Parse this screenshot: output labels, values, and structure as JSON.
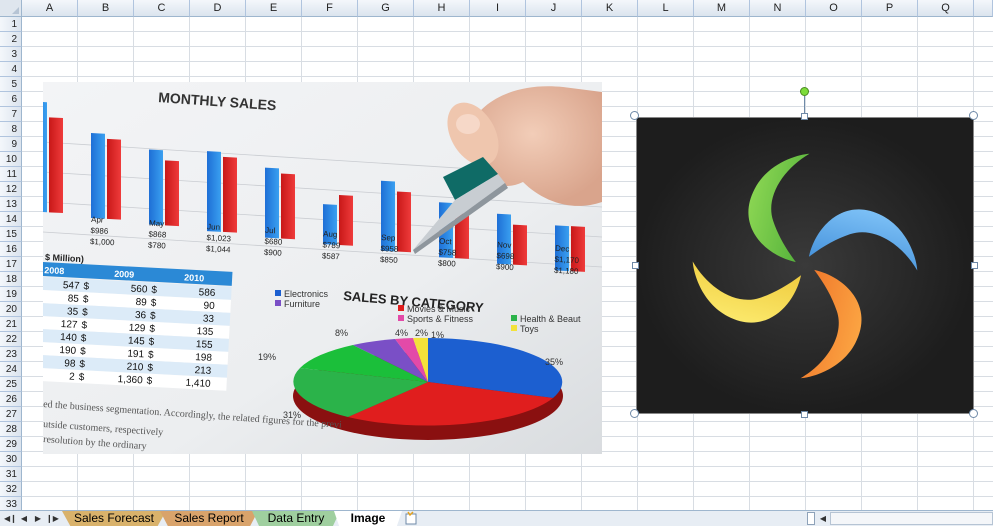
{
  "columns": [
    "A",
    "B",
    "C",
    "D",
    "E",
    "F",
    "G",
    "H",
    "I",
    "J",
    "K",
    "L",
    "M",
    "N",
    "O",
    "P",
    "Q"
  ],
  "rows": [
    "1",
    "2",
    "3",
    "4",
    "5",
    "6",
    "7",
    "8",
    "9",
    "10",
    "11",
    "12",
    "13",
    "14",
    "15",
    "16",
    "17",
    "18",
    "19",
    "20",
    "21",
    "22",
    "23",
    "24",
    "25",
    "26",
    "27",
    "28",
    "29",
    "30",
    "31",
    "32",
    "33"
  ],
  "photo": {
    "title": "MONTHLY SALES",
    "subtitle": "SALES BY CATEGORY",
    "months": [
      "Apr",
      "May",
      "Jun",
      "Jul",
      "Aug",
      "Sep",
      "Oct",
      "Nov",
      "Dec"
    ],
    "month_values_a": [
      "$986",
      "$868",
      "$1,023",
      "$680",
      "$789",
      "$958",
      "$758",
      "$698",
      "$1,170"
    ],
    "month_values_b": [
      "$1,000",
      "$780",
      "$1,044",
      "$900",
      "$587",
      "$850",
      "$800",
      "$900",
      "$1,180"
    ],
    "table_label": "$ Million)",
    "years": [
      "2008",
      "2009",
      "2010"
    ],
    "table_rows": [
      [
        "547",
        "560",
        "586"
      ],
      [
        "85",
        "89",
        "90"
      ],
      [
        "35",
        "36",
        "33"
      ],
      [
        "127",
        "129",
        "135"
      ],
      [
        "140",
        "145",
        "155"
      ],
      [
        "190",
        "191",
        "198"
      ],
      [
        "98",
        "210",
        "213"
      ],
      [
        "2",
        "1,360",
        "1,410"
      ]
    ],
    "legend": [
      "Electronics",
      "Furniture",
      "Movies & Music",
      "Sports & Fitness",
      "Health & Beaut",
      "Toys"
    ],
    "pie_labels": [
      "8%",
      "4%",
      "2%",
      "1%",
      "19%",
      "35%",
      "31%"
    ],
    "text_lines": [
      "ed the business segmentation. Accordingly, the related figures for the previ",
      "utside customers, respectively",
      "resolution by the ordinary"
    ]
  },
  "tabs": [
    {
      "label": "Sales Forecast",
      "color": "#d9b26b"
    },
    {
      "label": "Sales Report",
      "color": "#d9a36b"
    },
    {
      "label": "Data Entry",
      "color": "#9fcf9f"
    },
    {
      "label": "Image",
      "color": "#ffffff"
    }
  ],
  "nav_icons": [
    "first-sheet-icon",
    "prev-sheet-icon",
    "next-sheet-icon",
    "last-sheet-icon"
  ],
  "insert_sheet_icon": "insert-sheet-icon"
}
